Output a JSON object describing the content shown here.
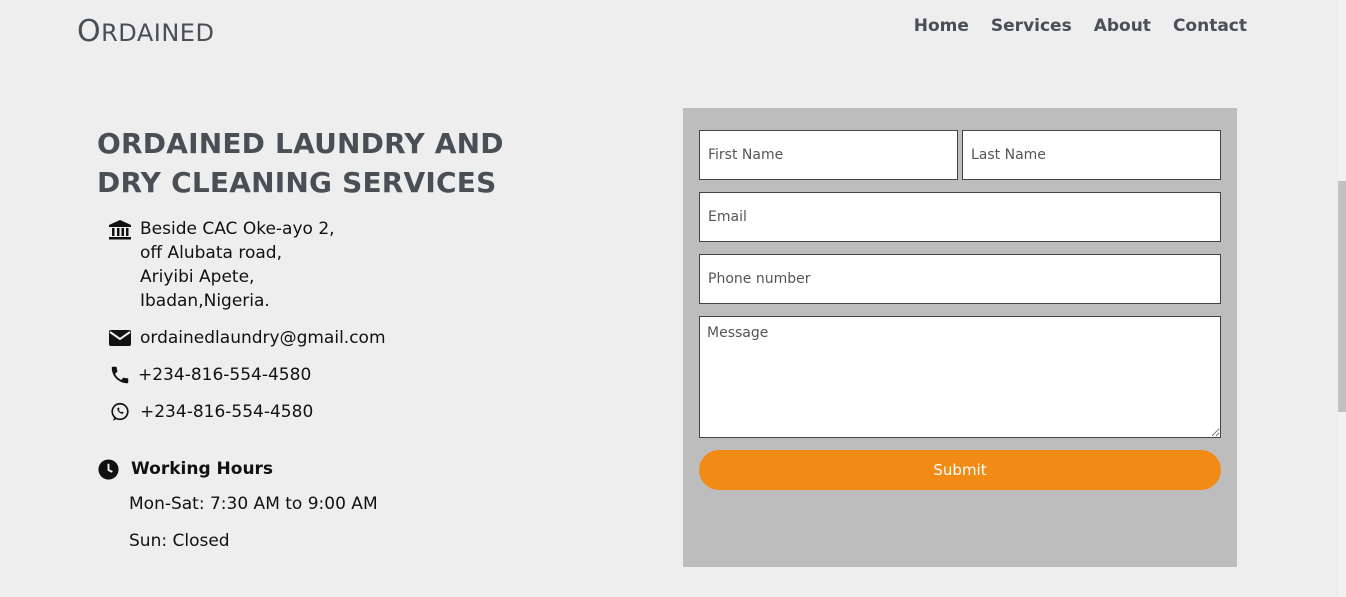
{
  "header": {
    "logo_first": "O",
    "logo_rest": "RDAINED",
    "nav": [
      "Home",
      "Services",
      "About",
      "Contact"
    ]
  },
  "info": {
    "company": "ORDAINED LAUNDRY AND DRY CLEANING SERVICES",
    "address": [
      "Beside CAC Oke-ayo 2,",
      "off Alubata road,",
      "Ariyibi Apete,",
      "Ibadan,Nigeria."
    ],
    "email": "ordainedlaundry@gmail.com",
    "phone": "+234-816-554-4580",
    "whatsapp": "+234-816-554-4580",
    "working_hours_title": "Working Hours",
    "hours": [
      "Mon-Sat: 7:30 AM to 9:00 AM",
      "Sun: Closed"
    ]
  },
  "form": {
    "first_name_placeholder": "First Name",
    "last_name_placeholder": "Last Name",
    "email_placeholder": "Email",
    "phone_placeholder": "Phone number",
    "message_placeholder": "Message",
    "submit_label": "Submit"
  },
  "colors": {
    "accent": "#f28a16",
    "panel": "#bdbdbd",
    "heading": "#4a4f55"
  }
}
